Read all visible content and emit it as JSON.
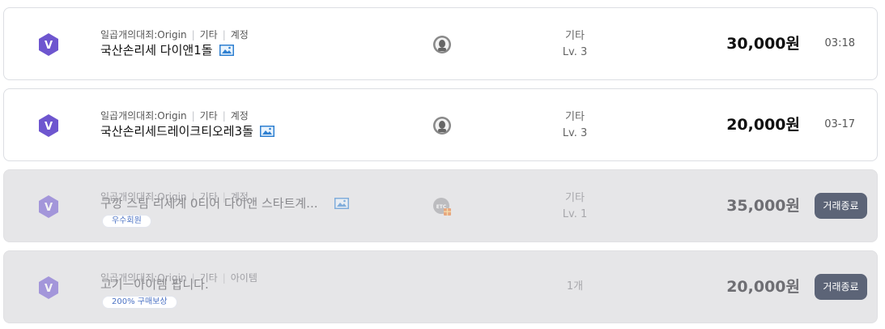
{
  "listings": [
    {
      "game": "일곱개의대죄:Origin",
      "server": "기타",
      "category": "계정",
      "title": "국산손리세 다이앤1돌",
      "has_image": true,
      "tag": "",
      "info_lines": [
        "기타",
        "Lv. 3"
      ],
      "price": "30,000원",
      "time": "03:18",
      "status": "",
      "seller_icon": "user-avatar-icon"
    },
    {
      "game": "일곱개의대죄:Origin",
      "server": "기타",
      "category": "계정",
      "title": "국산손리세드레이크티오레3돌",
      "has_image": true,
      "tag": "",
      "info_lines": [
        "기타",
        "Lv. 3"
      ],
      "price": "20,000원",
      "time": "03-17",
      "status": "",
      "seller_icon": "user-avatar-icon"
    },
    {
      "game": "일곱개의대죄:Origin",
      "server": "기타",
      "category": "계정",
      "title": "구깡 스팀 리세계 0티어 다이앤 스타트계...",
      "has_image": true,
      "tag": "우수회원",
      "info_lines": [
        "기타",
        "Lv. 1"
      ],
      "price": "35,000원",
      "time": "",
      "status": "거래종료",
      "seller_icon": "etc-gift-icon"
    },
    {
      "game": "일곱개의대죄:Origin",
      "server": "기타",
      "category": "아이템",
      "title": "고기ㅡ아이템 팝니다.",
      "has_image": false,
      "tag": "200% 구매보상",
      "info_lines": [
        "1개"
      ],
      "price": "20,000원",
      "time": "",
      "status": "거래종료",
      "seller_icon": ""
    }
  ],
  "colors": {
    "badge": "#6e56cf",
    "status_button": "#5c6477",
    "tag_text": "#4b72c4"
  },
  "badge_letter": "V"
}
